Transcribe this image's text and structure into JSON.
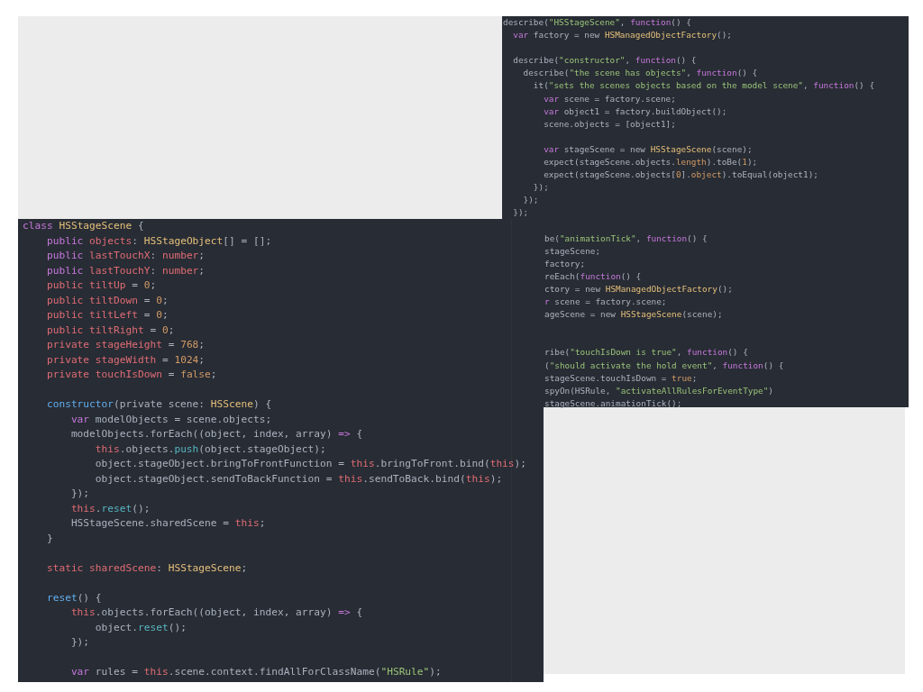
{
  "test_editor": {
    "lines": [
      {
        "kind": "code",
        "tokens": [
          {
            "text": "describe(",
            "kind": "plain"
          },
          {
            "text": "\"HSStageScene\"",
            "kind": "string"
          },
          {
            "text": ", ",
            "kind": "plain"
          },
          {
            "text": "function",
            "kind": "keyword"
          },
          {
            "text": "() {",
            "kind": "plain"
          }
        ],
        "children": [
          {
            "kind": "code",
            "tokens": [
              {
                "text": "var",
                "kind": "keyword"
              },
              {
                "text": " factory = new ",
                "kind": "plain"
              },
              {
                "text": "HSManagedObjectFactory",
                "kind": "type"
              },
              {
                "text": "();",
                "kind": "plain"
              }
            ]
          },
          {
            "kind": "blank"
          },
          {
            "kind": "code",
            "tokens": [
              {
                "text": "describe(",
                "kind": "plain"
              },
              {
                "text": "\"constructor\"",
                "kind": "string"
              },
              {
                "text": ", ",
                "kind": "plain"
              },
              {
                "text": "function",
                "kind": "keyword"
              },
              {
                "text": "() {",
                "kind": "plain"
              }
            ],
            "children": [
              {
                "kind": "code",
                "tokens": [
                  {
                    "text": "describe(",
                    "kind": "plain"
                  },
                  {
                    "text": "\"the scene has objects\"",
                    "kind": "string"
                  },
                  {
                    "text": ", ",
                    "kind": "plain"
                  },
                  {
                    "text": "function",
                    "kind": "keyword"
                  },
                  {
                    "text": "() {",
                    "kind": "plain"
                  }
                ],
                "children": [
                  {
                    "kind": "code",
                    "tokens": [
                      {
                        "text": "it(",
                        "kind": "plain"
                      },
                      {
                        "text": "\"sets the scenes objects based on the model scene\"",
                        "kind": "string"
                      },
                      {
                        "text": ", ",
                        "kind": "plain"
                      },
                      {
                        "text": "function",
                        "kind": "keyword"
                      },
                      {
                        "text": "() {",
                        "kind": "plain"
                      }
                    ],
                    "children": [
                      {
                        "kind": "code",
                        "tokens": [
                          {
                            "text": "var",
                            "kind": "keyword"
                          },
                          {
                            "text": " scene = factory.scene;",
                            "kind": "plain"
                          }
                        ]
                      },
                      {
                        "kind": "code",
                        "tokens": [
                          {
                            "text": "var",
                            "kind": "keyword"
                          },
                          {
                            "text": " object1 = factory.buildObject();",
                            "kind": "plain"
                          }
                        ]
                      },
                      {
                        "kind": "code",
                        "tokens": [
                          {
                            "text": "scene.objects = [object1];",
                            "kind": "plain"
                          }
                        ]
                      },
                      {
                        "kind": "blank"
                      },
                      {
                        "kind": "code",
                        "tokens": [
                          {
                            "text": "var",
                            "kind": "keyword"
                          },
                          {
                            "text": " stageScene = new ",
                            "kind": "plain"
                          },
                          {
                            "text": "HSStageScene",
                            "kind": "type"
                          },
                          {
                            "text": "(scene);",
                            "kind": "plain"
                          }
                        ]
                      },
                      {
                        "kind": "code",
                        "tokens": [
                          {
                            "text": "expect(stageScene.objects.",
                            "kind": "plain"
                          },
                          {
                            "text": "length",
                            "kind": "number"
                          },
                          {
                            "text": ").toBe(",
                            "kind": "plain"
                          },
                          {
                            "text": "1",
                            "kind": "number"
                          },
                          {
                            "text": ");",
                            "kind": "plain"
                          }
                        ]
                      },
                      {
                        "kind": "code",
                        "tokens": [
                          {
                            "text": "expect(stageScene.objects[",
                            "kind": "plain"
                          },
                          {
                            "text": "0",
                            "kind": "number"
                          },
                          {
                            "text": "].",
                            "kind": "plain"
                          },
                          {
                            "text": "object",
                            "kind": "number"
                          },
                          {
                            "text": ").toEqual(object1);",
                            "kind": "plain"
                          }
                        ]
                      }
                    ]
                  },
                  {
                    "kind": "code",
                    "tokens": [
                      {
                        "text": "});",
                        "kind": "plain"
                      }
                    ]
                  }
                ]
              },
              {
                "kind": "code",
                "tokens": [
                  {
                    "text": "});",
                    "kind": "plain"
                  }
                ]
              }
            ]
          },
          {
            "kind": "code",
            "tokens": [
              {
                "text": "});",
                "kind": "plain"
              }
            ]
          }
        ]
      },
      {
        "kind": "blank"
      },
      {
        "kind": "cut",
        "tokens": [
          {
            "text": "be(",
            "kind": "plain"
          },
          {
            "text": "\"animationTick\"",
            "kind": "string"
          },
          {
            "text": ", ",
            "kind": "plain"
          },
          {
            "text": "function",
            "kind": "keyword"
          },
          {
            "text": "() {",
            "kind": "plain"
          }
        ]
      },
      {
        "kind": "cut",
        "tokens": [
          {
            "text": "stageScene;",
            "kind": "plain"
          }
        ]
      },
      {
        "kind": "cut",
        "tokens": [
          {
            "text": "factory;",
            "kind": "plain"
          }
        ]
      },
      {
        "kind": "cut",
        "tokens": [
          {
            "text": "reEach(",
            "kind": "plain"
          },
          {
            "text": "function",
            "kind": "keyword"
          },
          {
            "text": "() {",
            "kind": "plain"
          }
        ]
      },
      {
        "kind": "cut",
        "tokens": [
          {
            "text": "ctory = new ",
            "kind": "plain"
          },
          {
            "text": "HSManagedObjectFactory",
            "kind": "type"
          },
          {
            "text": "();",
            "kind": "plain"
          }
        ]
      },
      {
        "kind": "cut",
        "tokens": [
          {
            "text": "r",
            "kind": "keyword"
          },
          {
            "text": " scene = factory.scene;",
            "kind": "plain"
          }
        ]
      },
      {
        "kind": "cut",
        "tokens": [
          {
            "text": "ageScene = new ",
            "kind": "plain"
          },
          {
            "text": "HSStageScene",
            "kind": "type"
          },
          {
            "text": "(scene);",
            "kind": "plain"
          }
        ]
      },
      {
        "kind": "blank"
      },
      {
        "kind": "blank"
      },
      {
        "kind": "cut",
        "tokens": [
          {
            "text": "ribe(",
            "kind": "plain"
          },
          {
            "text": "\"touchIsDown is true\"",
            "kind": "string"
          },
          {
            "text": ", ",
            "kind": "plain"
          },
          {
            "text": "function",
            "kind": "keyword"
          },
          {
            "text": "() {",
            "kind": "plain"
          }
        ]
      },
      {
        "kind": "cut",
        "tokens": [
          {
            "text": "(",
            "kind": "plain"
          },
          {
            "text": "\"should activate the hold event\"",
            "kind": "string"
          },
          {
            "text": ", ",
            "kind": "plain"
          },
          {
            "text": "function",
            "kind": "keyword"
          },
          {
            "text": "() {",
            "kind": "plain"
          }
        ]
      },
      {
        "kind": "cut",
        "tokens": [
          {
            "text": "stageScene.touchIsDown = ",
            "kind": "plain"
          },
          {
            "text": "true",
            "kind": "number"
          },
          {
            "text": ";",
            "kind": "plain"
          }
        ]
      },
      {
        "kind": "cut",
        "tokens": [
          {
            "text": "spyOn(HSRule, ",
            "kind": "plain"
          },
          {
            "text": "\"activateAllRulesForEventType\"",
            "kind": "string"
          },
          {
            "text": ")",
            "kind": "plain"
          }
        ]
      },
      {
        "kind": "cut",
        "tokens": [
          {
            "text": "stageScene.animationTick();",
            "kind": "plain"
          }
        ]
      }
    ]
  },
  "class_editor": {
    "lines": [
      {
        "kind": "code",
        "tokens": [
          {
            "text": "class",
            "kind": "keyword"
          },
          {
            "text": " HSStageScene",
            "kind": "type"
          },
          {
            "text": " {",
            "kind": "plain"
          }
        ],
        "children": [
          {
            "kind": "code",
            "tokens": [
              {
                "text": "public",
                "kind": "keyword"
              },
              {
                "text": " objects",
                "kind": "property"
              },
              {
                "text": ": ",
                "kind": "plain"
              },
              {
                "text": "HSStageObject",
                "kind": "type"
              },
              {
                "text": "[] = [];",
                "kind": "plain"
              }
            ]
          },
          {
            "kind": "code",
            "tokens": [
              {
                "text": "public",
                "kind": "keyword"
              },
              {
                "text": " lastTouchX",
                "kind": "property"
              },
              {
                "text": ": ",
                "kind": "plain"
              },
              {
                "text": "number",
                "kind": "property"
              },
              {
                "text": ";",
                "kind": "plain"
              }
            ]
          },
          {
            "kind": "code",
            "tokens": [
              {
                "text": "public",
                "kind": "keyword"
              },
              {
                "text": " lastTouchY",
                "kind": "property"
              },
              {
                "text": ": ",
                "kind": "plain"
              },
              {
                "text": "number",
                "kind": "property"
              },
              {
                "text": ";",
                "kind": "plain"
              }
            ]
          },
          {
            "kind": "code",
            "tokens": [
              {
                "text": "public tiltUp",
                "kind": "property"
              },
              {
                "text": " = ",
                "kind": "plain"
              },
              {
                "text": "0",
                "kind": "number"
              },
              {
                "text": ";",
                "kind": "plain"
              }
            ]
          },
          {
            "kind": "code",
            "tokens": [
              {
                "text": "public tiltDown",
                "kind": "property"
              },
              {
                "text": " = ",
                "kind": "plain"
              },
              {
                "text": "0",
                "kind": "number"
              },
              {
                "text": ";",
                "kind": "plain"
              }
            ]
          },
          {
            "kind": "code",
            "tokens": [
              {
                "text": "public tiltLeft",
                "kind": "property"
              },
              {
                "text": " = ",
                "kind": "plain"
              },
              {
                "text": "0",
                "kind": "number"
              },
              {
                "text": ";",
                "kind": "plain"
              }
            ]
          },
          {
            "kind": "code",
            "tokens": [
              {
                "text": "public tiltRight",
                "kind": "property"
              },
              {
                "text": " = ",
                "kind": "plain"
              },
              {
                "text": "0",
                "kind": "number"
              },
              {
                "text": ";",
                "kind": "plain"
              }
            ]
          },
          {
            "kind": "code",
            "tokens": [
              {
                "text": "private stageHeight",
                "kind": "property"
              },
              {
                "text": " = ",
                "kind": "plain"
              },
              {
                "text": "768",
                "kind": "number"
              },
              {
                "text": ";",
                "kind": "plain"
              }
            ]
          },
          {
            "kind": "code",
            "tokens": [
              {
                "text": "private stageWidth",
                "kind": "property"
              },
              {
                "text": " = ",
                "kind": "plain"
              },
              {
                "text": "1024",
                "kind": "number"
              },
              {
                "text": ";",
                "kind": "plain"
              }
            ]
          },
          {
            "kind": "code",
            "tokens": [
              {
                "text": "private touchIsDown",
                "kind": "property"
              },
              {
                "text": " = ",
                "kind": "plain"
              },
              {
                "text": "false",
                "kind": "number"
              },
              {
                "text": ";",
                "kind": "plain"
              }
            ]
          },
          {
            "kind": "blank"
          },
          {
            "kind": "code",
            "tokens": [
              {
                "text": "constructor",
                "kind": "function"
              },
              {
                "text": "(private scene: ",
                "kind": "plain"
              },
              {
                "text": "HSScene",
                "kind": "type"
              },
              {
                "text": ") {",
                "kind": "plain"
              }
            ],
            "children": [
              {
                "kind": "code",
                "tokens": [
                  {
                    "text": "var",
                    "kind": "keyword"
                  },
                  {
                    "text": " modelObjects = scene.objects;",
                    "kind": "plain"
                  }
                ]
              },
              {
                "kind": "code",
                "tokens": [
                  {
                    "text": "modelObjects.forEach((object, index, array) ",
                    "kind": "plain"
                  },
                  {
                    "text": "=>",
                    "kind": "keyword"
                  },
                  {
                    "text": " {",
                    "kind": "plain"
                  }
                ],
                "children": [
                  {
                    "kind": "code",
                    "tokens": [
                      {
                        "text": "this",
                        "kind": "property"
                      },
                      {
                        "text": ".objects.",
                        "kind": "plain"
                      },
                      {
                        "text": "push",
                        "kind": "method"
                      },
                      {
                        "text": "(object.stageObject);",
                        "kind": "plain"
                      }
                    ]
                  },
                  {
                    "kind": "code",
                    "tokens": [
                      {
                        "text": "object.stageObject.bringToFrontFunction = ",
                        "kind": "plain"
                      },
                      {
                        "text": "this",
                        "kind": "property"
                      },
                      {
                        "text": ".bringToFront.bind(",
                        "kind": "plain"
                      },
                      {
                        "text": "this",
                        "kind": "property"
                      },
                      {
                        "text": ");",
                        "kind": "plain"
                      }
                    ]
                  },
                  {
                    "kind": "code",
                    "tokens": [
                      {
                        "text": "object.stageObject.sendToBackFunction = ",
                        "kind": "plain"
                      },
                      {
                        "text": "this",
                        "kind": "property"
                      },
                      {
                        "text": ".sendToBack.bind(",
                        "kind": "plain"
                      },
                      {
                        "text": "this",
                        "kind": "property"
                      },
                      {
                        "text": ");",
                        "kind": "plain"
                      }
                    ]
                  }
                ]
              },
              {
                "kind": "code",
                "tokens": [
                  {
                    "text": "});",
                    "kind": "plain"
                  }
                ]
              },
              {
                "kind": "code",
                "tokens": [
                  {
                    "text": "this",
                    "kind": "property"
                  },
                  {
                    "text": ".",
                    "kind": "plain"
                  },
                  {
                    "text": "reset",
                    "kind": "method"
                  },
                  {
                    "text": "();",
                    "kind": "plain"
                  }
                ]
              },
              {
                "kind": "code",
                "tokens": [
                  {
                    "text": "HSStageScene.sharedScene = ",
                    "kind": "plain"
                  },
                  {
                    "text": "this",
                    "kind": "property"
                  },
                  {
                    "text": ";",
                    "kind": "plain"
                  }
                ]
              }
            ]
          },
          {
            "kind": "code",
            "tokens": [
              {
                "text": "}",
                "kind": "plain"
              }
            ]
          },
          {
            "kind": "blank"
          },
          {
            "kind": "code",
            "tokens": [
              {
                "text": "static sharedScene",
                "kind": "property"
              },
              {
                "text": ": ",
                "kind": "plain"
              },
              {
                "text": "HSStageScene",
                "kind": "type"
              },
              {
                "text": ";",
                "kind": "plain"
              }
            ]
          },
          {
            "kind": "blank"
          },
          {
            "kind": "code",
            "tokens": [
              {
                "text": "reset",
                "kind": "function"
              },
              {
                "text": "() {",
                "kind": "plain"
              }
            ],
            "children": [
              {
                "kind": "code",
                "tokens": [
                  {
                    "text": "this",
                    "kind": "property"
                  },
                  {
                    "text": ".objects.forEach((object, index, array) ",
                    "kind": "plain"
                  },
                  {
                    "text": "=>",
                    "kind": "keyword"
                  },
                  {
                    "text": " {",
                    "kind": "plain"
                  }
                ],
                "children": [
                  {
                    "kind": "code",
                    "tokens": [
                      {
                        "text": "object.",
                        "kind": "plain"
                      },
                      {
                        "text": "reset",
                        "kind": "method"
                      },
                      {
                        "text": "();",
                        "kind": "plain"
                      }
                    ]
                  }
                ]
              },
              {
                "kind": "code",
                "tokens": [
                  {
                    "text": "});",
                    "kind": "plain"
                  }
                ]
              },
              {
                "kind": "blank"
              },
              {
                "kind": "code",
                "tokens": [
                  {
                    "text": "var",
                    "kind": "keyword"
                  },
                  {
                    "text": " rules = ",
                    "kind": "plain"
                  },
                  {
                    "text": "this",
                    "kind": "property"
                  },
                  {
                    "text": ".scene.context.findAllForClassName(",
                    "kind": "plain"
                  },
                  {
                    "text": "\"HSRule\"",
                    "kind": "string"
                  },
                  {
                    "text": ");",
                    "kind": "plain"
                  }
                ]
              }
            ]
          }
        ]
      }
    ]
  }
}
